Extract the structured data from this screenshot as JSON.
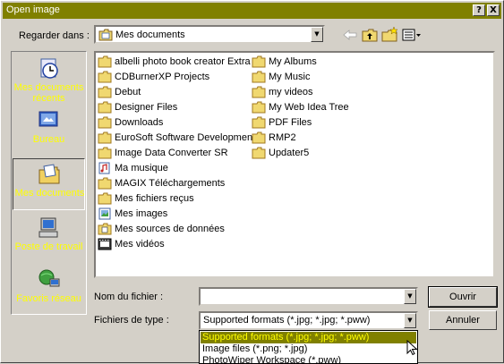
{
  "window": {
    "title": "Open image",
    "help_label": "?",
    "close_label": "X"
  },
  "lookin": {
    "label": "Regarder dans :",
    "value": "Mes documents"
  },
  "places": [
    {
      "label": "Mes documents récents",
      "icon": "recent-documents-icon"
    },
    {
      "label": "Bureau",
      "icon": "desktop-icon"
    },
    {
      "label": "Mes documents",
      "icon": "my-documents-icon",
      "selected": true
    },
    {
      "label": "Poste de travail",
      "icon": "my-computer-icon"
    },
    {
      "label": "Favoris réseau",
      "icon": "network-places-icon"
    }
  ],
  "files_col1": [
    {
      "name": "albelli photo book creator Extra",
      "icon": "folder-icon"
    },
    {
      "name": "CDBurnerXP Projects",
      "icon": "folder-icon"
    },
    {
      "name": "Debut",
      "icon": "folder-icon"
    },
    {
      "name": "Designer Files",
      "icon": "folder-icon"
    },
    {
      "name": "Downloads",
      "icon": "folder-icon"
    },
    {
      "name": "EuroSoft Software Development",
      "icon": "folder-icon"
    },
    {
      "name": "Image Data Converter SR",
      "icon": "folder-icon"
    },
    {
      "name": "Ma musique",
      "icon": "music-folder-icon"
    },
    {
      "name": "MAGIX Téléchargements",
      "icon": "folder-icon"
    },
    {
      "name": "Mes fichiers reçus",
      "icon": "folder-icon"
    },
    {
      "name": "Mes images",
      "icon": "pictures-folder-icon"
    },
    {
      "name": "Mes sources de données",
      "icon": "data-sources-folder-icon"
    },
    {
      "name": "Mes vidéos",
      "icon": "videos-folder-icon"
    }
  ],
  "files_col2": [
    {
      "name": "My Albums",
      "icon": "folder-icon"
    },
    {
      "name": "My Music",
      "icon": "folder-icon"
    },
    {
      "name": "my videos",
      "icon": "folder-icon"
    },
    {
      "name": "My Web Idea Tree",
      "icon": "folder-icon"
    },
    {
      "name": "PDF Files",
      "icon": "folder-icon"
    },
    {
      "name": "RMP2",
      "icon": "folder-icon"
    },
    {
      "name": "Updater5",
      "icon": "folder-icon"
    }
  ],
  "filename": {
    "label": "Nom du fichier :",
    "value": ""
  },
  "filetype": {
    "label": "Fichiers de type :",
    "value": "Supported formats (*.jpg; *.jpg; *.pww)",
    "options": [
      "Supported formats (*.jpg; *.jpg; *.pww)",
      "Image files (*.png; *.jpg)",
      "PhotoWiper Workspace (*.pww)"
    ]
  },
  "buttons": {
    "open": "Ouvrir",
    "cancel": "Annuler"
  },
  "colors": {
    "titlebar": "#808000",
    "highlight_bg": "#808000",
    "highlight_fg": "#ffff00",
    "places_text": "#ffff00",
    "face": "#d4d0c8"
  }
}
